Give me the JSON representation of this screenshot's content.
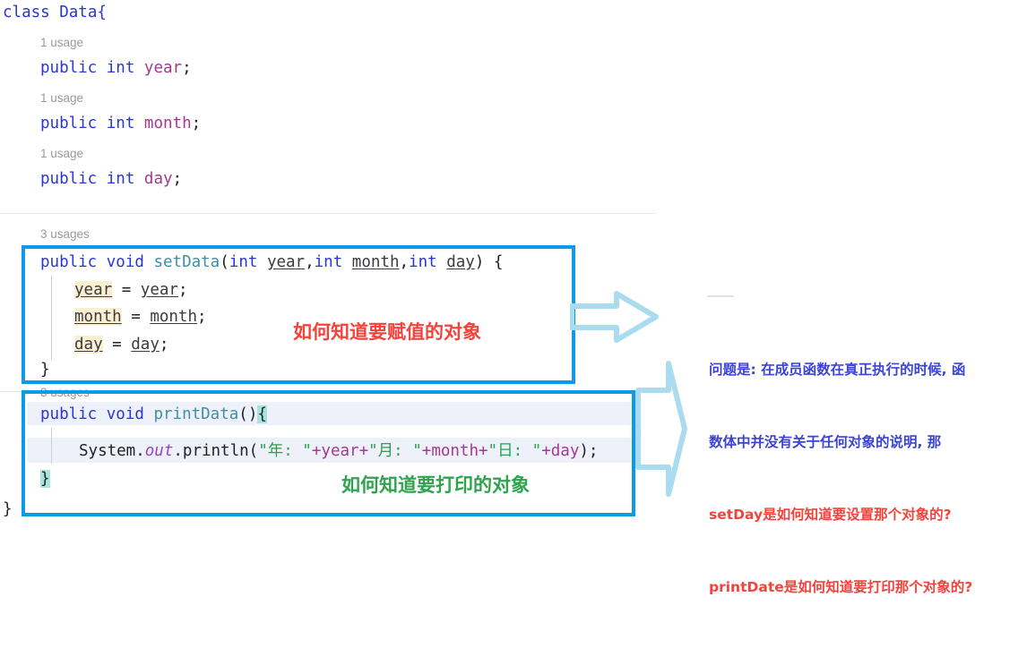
{
  "editor": {
    "class_decl": "class Data{",
    "class_close": "}",
    "usage_labels": {
      "one": "1 usage",
      "three": "3 usages"
    },
    "fields": [
      {
        "usage": "1 usage",
        "modifier": "public",
        "type": "int",
        "name": "year",
        "semi": ";"
      },
      {
        "usage": "1 usage",
        "modifier": "public",
        "type": "int",
        "name": "month",
        "semi": ";"
      },
      {
        "usage": "1 usage",
        "modifier": "public",
        "type": "int",
        "name": "day",
        "semi": ";"
      }
    ],
    "set_method": {
      "usage": "3 usages",
      "signature_parts": {
        "modifier": "public",
        "ret": "void",
        "name": "setData",
        "open_paren": "(",
        "p1_type": "int",
        "p1_name": "year",
        "comma1": ",",
        "p2_type": "int",
        "p2_name": "month",
        "comma2": ",",
        "p3_type": "int",
        "p3_name": "day",
        "close_paren": ")",
        "brace": "{"
      },
      "body": [
        {
          "lhs": "year",
          "eq": "=",
          "rhs": "year",
          "semi": ";"
        },
        {
          "lhs": "month",
          "eq": "=",
          "rhs": "month",
          "semi": ";"
        },
        {
          "lhs": "day",
          "eq": "=",
          "rhs": "day",
          "semi": ";"
        }
      ],
      "close": "}"
    },
    "print_method": {
      "usage": "3 usages",
      "signature_parts": {
        "modifier": "public",
        "ret": "void",
        "name": "printData",
        "parens": "()",
        "brace": "{"
      },
      "body_parts": {
        "system": "System.",
        "out": "out",
        "dot_println": ".println(",
        "s1": "\"年: \"",
        "plus1": "+",
        "v1": "year",
        "plus2": "+",
        "s2": "\"月: \"",
        "plus3": "+",
        "v2": "month",
        "plus4": "+",
        "s3": "\"日: \"",
        "plus5": "+",
        "v3": "day",
        "tail": ");"
      },
      "close": "}"
    }
  },
  "annotations": {
    "set_note": "如何知道要赋值的对象",
    "print_note": "如何知道要打印的对象"
  },
  "side_note": {
    "line1": "问题是: 在成员函数在真正执行的时候, 函",
    "line2": "数体中并没有关于任何对象的说明, 那",
    "line3": "setDay是如何知道要设置那个对象的?",
    "line4": "printDate是如何知道要打印那个对象的?"
  },
  "colors": {
    "box_border": "#0d9ae8",
    "arrow": "#a9dcee",
    "note_blue": "#3b43d8",
    "note_red": "#f2433c",
    "ann_red": "#f2433c",
    "ann_green": "#2fa34d",
    "keyword": "#2a35d6",
    "method": "#3f8fa8",
    "field": "#a4388f",
    "string": "#2e9e4f",
    "usage_gray": "#9a9a9a",
    "highlight_cream": "#fbefd2",
    "highlight_teal": "#a8e4de"
  },
  "icons": {
    "arrow_right_1": "block-arrow-right-icon",
    "arrow_right_2": "block-arrow-right-tall-icon"
  }
}
